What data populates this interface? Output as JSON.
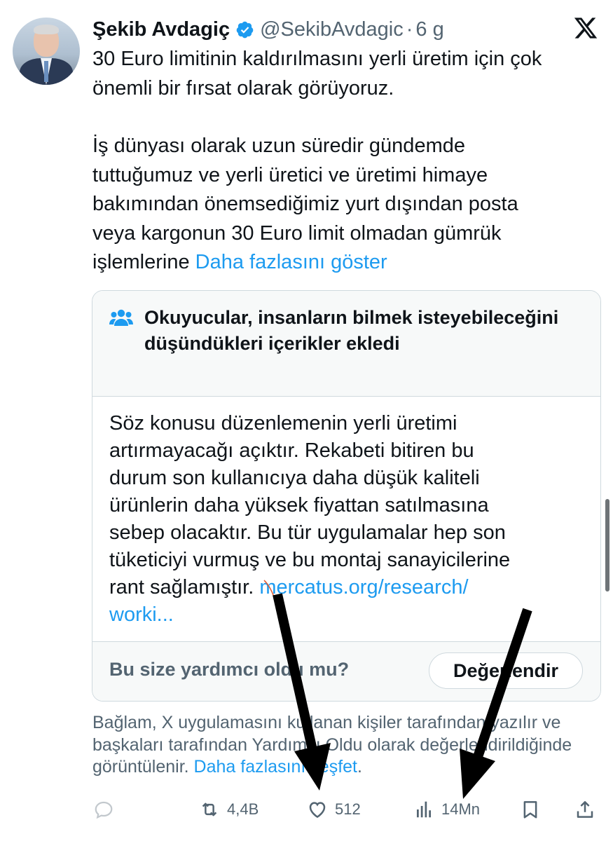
{
  "author": {
    "name": "Şekib Avdagiç",
    "handle": "@SekibAvdagic",
    "separator": "·",
    "time": "6 g"
  },
  "tweet": {
    "lines_p1": [
      "30 Euro limitinin kaldırılmasını yerli üretim için çok",
      "önemli bir fırsat olarak görüyoruz."
    ],
    "lines_p2": [
      "İş dünyası olarak uzun süredir gündemde",
      "tuttuğumuz ve yerli üretici ve üretimi himaye",
      "bakımından önemsediğimiz yurt dışından posta",
      "veya kargonun 30 Euro limit olmadan gümrük"
    ],
    "last_line_prefix": "işlemlerine ",
    "show_more": "Daha fazlasını göster"
  },
  "community_note": {
    "title": "Okuyucular, insanların bilmek isteyebileceğini düşündükleri içerikler ekledi",
    "body_lines": [
      "Söz konusu düzenlemenin yerli üretimi",
      "artırmayacağı açıktır. Rekabeti bitiren bu",
      "durum son kullanıcıya daha düşük kaliteli",
      "ürünlerin daha yüksek fiyattan satılmasına",
      "sebep olacaktır. Bu tür uygulamalar hep son",
      "tüketiciyi vurmuş ve bu montaj sanayicilerine"
    ],
    "body_last_prefix": "rant sağlamıştır. ",
    "link_part1": "mercatus.org/research/",
    "link_part2": "worki...",
    "helpful_question": "Bu size yardımcı oldu mu?",
    "rate_button": "Değerlendir"
  },
  "context": {
    "text": "Bağlam, X uygulamasını kullanan kişiler tarafından yazılır ve başkaları tarafından Yardımcı Oldu olarak değerlendirildiğinde görüntülenir. ",
    "link": "Daha fazlasını keşfet",
    "end": "."
  },
  "actions": {
    "retweets": "4,4B",
    "likes": "512",
    "views": "14Mn"
  },
  "icons": {
    "verified": "verified-badge-icon",
    "x_logo": "x-logo-icon",
    "note": "people-icon",
    "reply": "reply-icon",
    "retweet": "retweet-icon",
    "like": "heart-icon",
    "views": "bar-chart-icon",
    "bookmark": "bookmark-icon",
    "share": "share-icon"
  },
  "colors": {
    "link": "#1d9bf0",
    "secondary_text": "#536471",
    "arrow": "#000000"
  }
}
